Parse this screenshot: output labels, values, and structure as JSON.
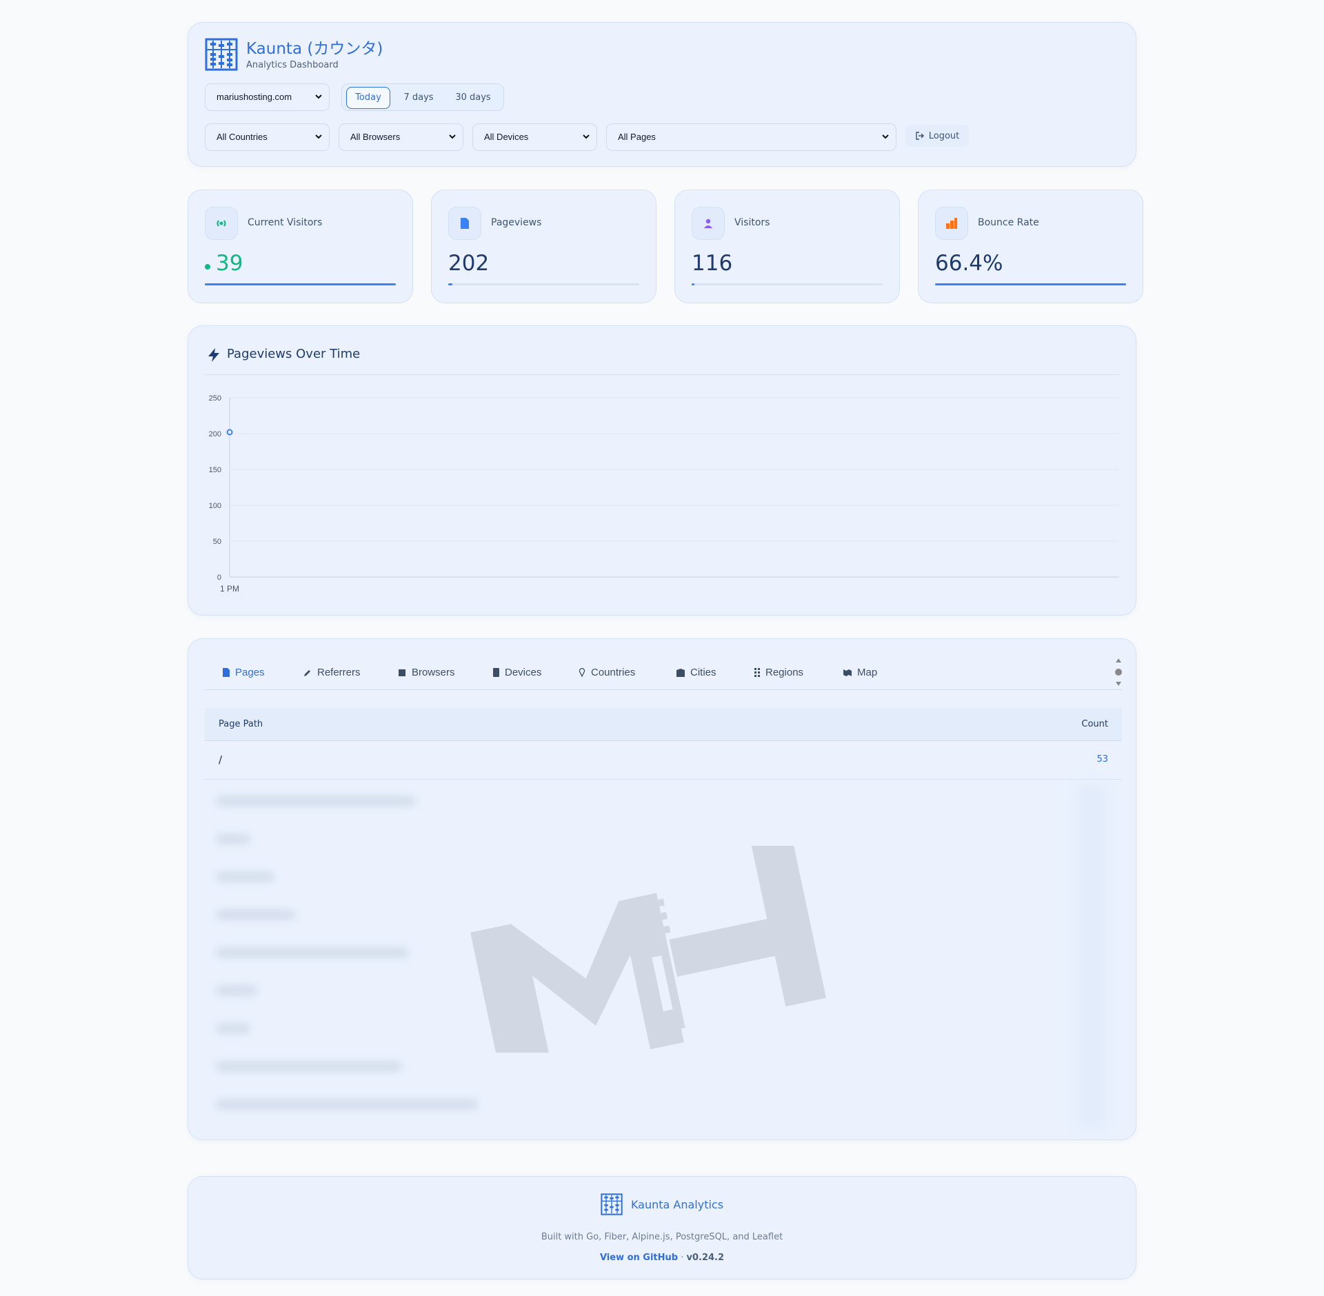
{
  "header": {
    "title": "Kaunta (カウンタ)",
    "subtitle": "Analytics Dashboard",
    "site_select": "mariushosting.com",
    "ranges": [
      "Today",
      "7 days",
      "30 days"
    ],
    "active_range": "Today",
    "filters": {
      "countries": "All Countries",
      "browsers": "All Browsers",
      "devices": "All Devices",
      "pages": "All Pages"
    },
    "logout_label": "Logout"
  },
  "stats": [
    {
      "label": "Current Visitors",
      "value": "39",
      "icon": "broadcast-icon",
      "color": "#10b981",
      "bar_fraction": 1.0
    },
    {
      "label": "Pageviews",
      "value": "202",
      "icon": "document-icon",
      "color": "#3b82f6",
      "bar_fraction": 0.02
    },
    {
      "label": "Visitors",
      "value": "116",
      "icon": "user-icon",
      "color": "#8b5cf6",
      "bar_fraction": 0.015
    },
    {
      "label": "Bounce Rate",
      "value": "66.4%",
      "icon": "bar-chart-icon",
      "color": "#f97316",
      "bar_fraction": 1.0
    }
  ],
  "chart": {
    "title": "Pageviews Over Time"
  },
  "chart_data": {
    "type": "line",
    "title": "Pageviews Over Time",
    "x": [
      "1 PM"
    ],
    "series": [
      {
        "values": [
          202
        ]
      }
    ],
    "yticks": [
      0,
      50,
      100,
      150,
      200,
      250
    ],
    "ylim": [
      0,
      250
    ],
    "grid": true,
    "colors": {
      "line": "#3b82f6"
    }
  },
  "tabs": [
    {
      "label": "Pages",
      "icon": "document-icon"
    },
    {
      "label": "Referrers",
      "icon": "pencil-icon"
    },
    {
      "label": "Browsers",
      "icon": "square-icon"
    },
    {
      "label": "Devices",
      "icon": "phone-icon"
    },
    {
      "label": "Countries",
      "icon": "pin-icon"
    },
    {
      "label": "Cities",
      "icon": "building-icon"
    },
    {
      "label": "Regions",
      "icon": "grid-icon"
    },
    {
      "label": "Map",
      "icon": "map-icon"
    }
  ],
  "table": {
    "col_path": "Page Path",
    "col_count": "Count",
    "rows": [
      {
        "path": "/",
        "count": "53"
      }
    ]
  },
  "footer": {
    "title": "Kaunta Analytics",
    "built": "Built with Go, Fiber, Alpine.js, PostgreSQL, and Leaflet",
    "github": "View on GitHub",
    "separator": " · ",
    "version": "v0.24.2"
  }
}
